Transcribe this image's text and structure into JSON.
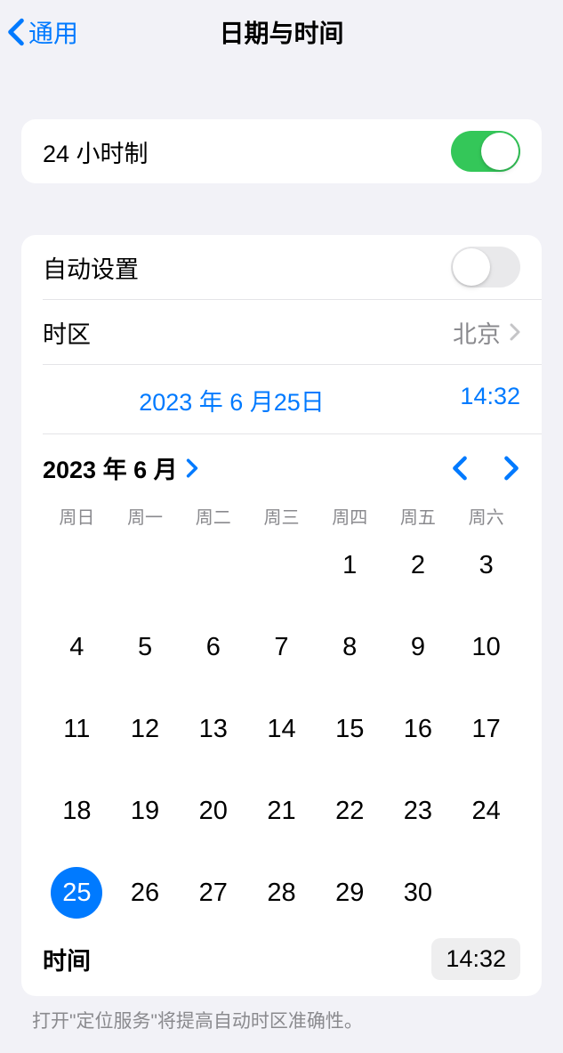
{
  "nav": {
    "back_label": "通用",
    "title": "日期与时间"
  },
  "clock24": {
    "label": "24 小时制",
    "enabled": true
  },
  "auto_set": {
    "label": "自动设置",
    "enabled": false
  },
  "timezone": {
    "label": "时区",
    "value": "北京"
  },
  "selected": {
    "date": "2023 年 6 月25日",
    "time": "14:32"
  },
  "calendar": {
    "month_label": "2023 年 6 月",
    "weekdays": [
      "周日",
      "周一",
      "周二",
      "周三",
      "周四",
      "周五",
      "周六"
    ],
    "leading_blanks": 4,
    "days": [
      1,
      2,
      3,
      4,
      5,
      6,
      7,
      8,
      9,
      10,
      11,
      12,
      13,
      14,
      15,
      16,
      17,
      18,
      19,
      20,
      21,
      22,
      23,
      24,
      25,
      26,
      27,
      28,
      29,
      30
    ],
    "selected_day": 25
  },
  "time_row": {
    "label": "时间",
    "value": "14:32"
  },
  "footer": "打开\"定位服务\"将提高自动时区准确性。"
}
